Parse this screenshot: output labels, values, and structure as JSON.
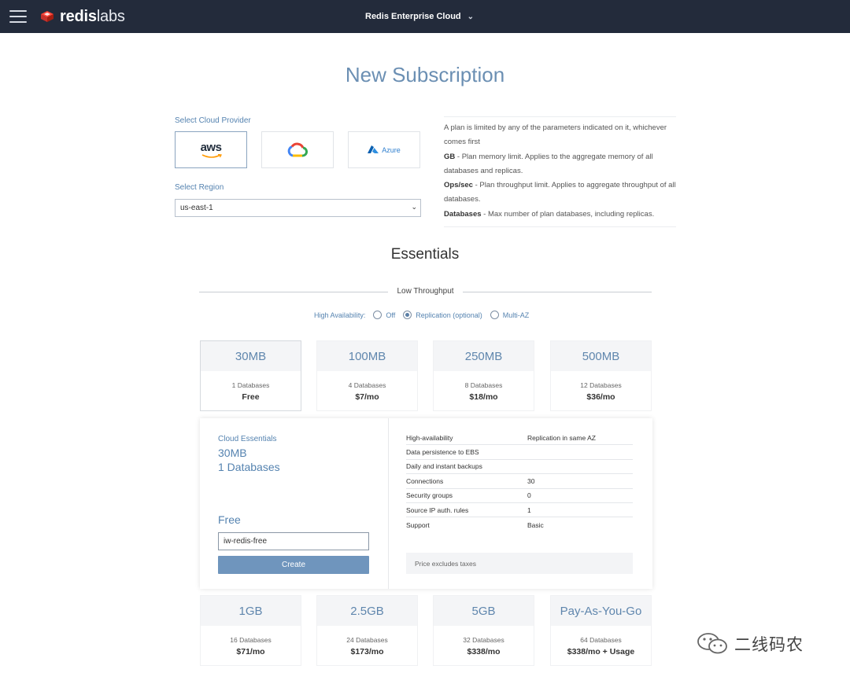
{
  "topbar": {
    "logo_bold": "redis",
    "logo_light": "labs",
    "environment": "Redis Enterprise Cloud"
  },
  "page_title": "New Subscription",
  "provider": {
    "label": "Select Cloud Provider",
    "options": [
      {
        "name": "aws",
        "text": "aws",
        "selected": true
      },
      {
        "name": "gcp",
        "text": "",
        "selected": false
      },
      {
        "name": "azure",
        "text": "Azure",
        "selected": false
      }
    ]
  },
  "region": {
    "label": "Select Region",
    "value": "us-east-1"
  },
  "info": {
    "intro": "A plan is limited by any of the parameters indicated on it, whichever comes first",
    "gb_term": "GB",
    "gb_desc": " - Plan memory limit. Applies to the aggregate memory of all databases and replicas.",
    "ops_term": "Ops/sec",
    "ops_desc": " - Plan throughput limit. Applies to aggregate throughput of all databases.",
    "db_term": "Databases",
    "db_desc": " - Max number of plan databases, including replicas."
  },
  "essentials_title": "Essentials",
  "throughput_label": "Low Throughput",
  "high_availability": {
    "label": "High Availability:",
    "options": [
      {
        "label": "Off",
        "checked": false
      },
      {
        "label": "Replication (optional)",
        "checked": true
      },
      {
        "label": "Multi-AZ",
        "checked": false
      }
    ]
  },
  "plans_row1": [
    {
      "size": "30MB",
      "databases": "1 Databases",
      "price": "Free",
      "selected": true
    },
    {
      "size": "100MB",
      "databases": "4 Databases",
      "price": "$7/mo",
      "selected": false
    },
    {
      "size": "250MB",
      "databases": "8 Databases",
      "price": "$18/mo",
      "selected": false
    },
    {
      "size": "500MB",
      "databases": "12 Databases",
      "price": "$36/mo",
      "selected": false
    }
  ],
  "plans_row2": [
    {
      "size": "1GB",
      "databases": "16 Databases",
      "price": "$71/mo",
      "selected": false
    },
    {
      "size": "2.5GB",
      "databases": "24 Databases",
      "price": "$173/mo",
      "selected": false
    },
    {
      "size": "5GB",
      "databases": "32 Databases",
      "price": "$338/mo",
      "selected": false
    },
    {
      "size": "Pay-As-You-Go",
      "databases": "64 Databases",
      "price": "$338/mo + Usage",
      "selected": false
    }
  ],
  "detail": {
    "tag": "Cloud Essentials",
    "size": "30MB",
    "databases": "1 Databases",
    "price": "Free",
    "name_value": "iw-redis-free",
    "create_label": "Create",
    "specs": [
      {
        "key": "High-availability",
        "value": "Replication in same AZ"
      },
      {
        "key": "Data persistence to EBS",
        "value": ""
      },
      {
        "key": "Daily and instant backups",
        "value": ""
      },
      {
        "key": "Connections",
        "value": "30"
      },
      {
        "key": "Security groups",
        "value": "0"
      },
      {
        "key": "Source IP auth. rules",
        "value": "1"
      },
      {
        "key": "Support",
        "value": "Basic"
      }
    ],
    "tax_note": "Price excludes taxes"
  },
  "watermark": "二线码农"
}
